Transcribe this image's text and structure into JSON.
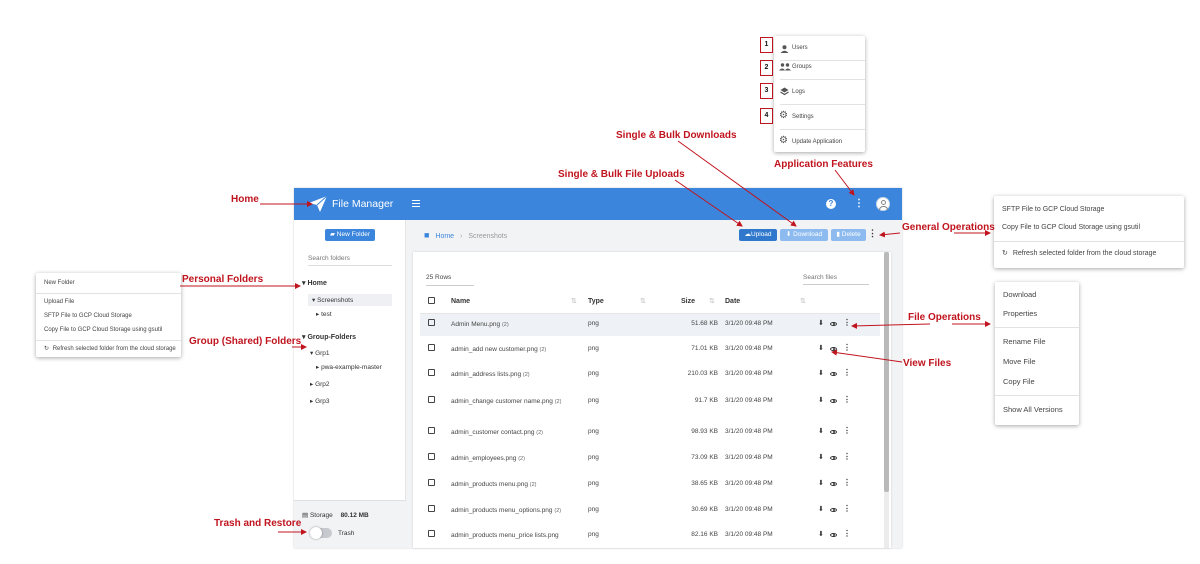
{
  "annotations": {
    "home": "Home",
    "personal_folders": "Personal Folders",
    "group_folders": "Group (Shared) Folders",
    "trash_restore": "Trash and Restore",
    "single_bulk_downloads": "Single & Bulk Downloads",
    "single_bulk_uploads": "Single & Bulk File Uploads",
    "application_features": "Application Features",
    "general_operations": "General Operations",
    "file_operations": "File Operations",
    "view_files": "View Files"
  },
  "app_features_menu": {
    "items": [
      {
        "number": "1",
        "label": "Users",
        "icon": "user-icon"
      },
      {
        "number": "2",
        "label": "Groups",
        "icon": "group-icon"
      },
      {
        "number": "3",
        "label": "Logs",
        "icon": "layers-icon"
      },
      {
        "number": "4",
        "label": "Settings",
        "icon": "gear-icon"
      },
      {
        "number": "",
        "label": "Update Application",
        "icon": "gear-icon"
      }
    ]
  },
  "general_operations_menu": {
    "items": [
      "SFTP File to GCP Cloud Storage",
      "Copy File to GCP Cloud Storage using gsutil",
      "Refresh selected folder from the cloud storage"
    ]
  },
  "personal_context_menu": {
    "items": [
      "New Folder",
      "Upload File",
      "SFTP File to GCP Cloud Storage",
      "Copy File to GCP Cloud Storage using gsutil",
      "Refresh selected folder from the cloud storage"
    ]
  },
  "file_operations_menu": {
    "items": [
      "Download",
      "Properties",
      "Rename File",
      "Move File",
      "Copy File",
      "Show All Versions"
    ]
  },
  "app": {
    "title": "File Manager",
    "new_folder": "New Folder",
    "search_folders_placeholder": "Search folders",
    "home_label": "Home",
    "personal_tree": [
      "Screenshots",
      "test"
    ],
    "group_label": "Group-Folders",
    "group_tree": [
      "Grp1",
      "pwa-example-master",
      "Grp2",
      "Grp3"
    ],
    "storage_label": "Storage",
    "storage_value": "80.12 MB",
    "trash_label": "Trash",
    "breadcrumb": [
      "Home",
      "Screenshots"
    ],
    "upload": "Upload",
    "download": "Download",
    "delete": "Delete",
    "rows_count": "25 Rows",
    "search_files_placeholder": "Search files",
    "columns": [
      "Name",
      "Type",
      "Size",
      "Date"
    ]
  },
  "files": [
    {
      "name": "Admin Menu.png",
      "versions": "(2)",
      "type": "png",
      "size": "51.68 KB",
      "date": "3/1/20 09:48 PM"
    },
    {
      "name": "admin_add new customer.png",
      "versions": "(2)",
      "type": "png",
      "size": "71.01 KB",
      "date": "3/1/20 09:48 PM"
    },
    {
      "name": "admin_address lists.png",
      "versions": "(2)",
      "type": "png",
      "size": "210.03 KB",
      "date": "3/1/20 09:48 PM"
    },
    {
      "name": "admin_change customer name.png",
      "versions": "(2)",
      "type": "png",
      "size": "91.7 KB",
      "date": "3/1/20 09:48 PM"
    },
    {
      "name": "admin_customer contact.png",
      "versions": "(2)",
      "type": "png",
      "size": "98.93 KB",
      "date": "3/1/20 09:48 PM"
    },
    {
      "name": "admin_employees.png",
      "versions": "(2)",
      "type": "png",
      "size": "73.09 KB",
      "date": "3/1/20 09:48 PM"
    },
    {
      "name": "admin_products menu.png",
      "versions": "(2)",
      "type": "png",
      "size": "38.65 KB",
      "date": "3/1/20 09:48 PM"
    },
    {
      "name": "admin_products menu_options.png",
      "versions": "(2)",
      "type": "png",
      "size": "30.69 KB",
      "date": "3/1/20 09:48 PM"
    },
    {
      "name": "admin_products menu_price lists.png",
      "versions": "",
      "type": "png",
      "size": "82.16 KB",
      "date": "3/1/20 09:48 PM"
    }
  ],
  "colors": {
    "accent": "#3b86dc",
    "annotation": "#c0141e"
  }
}
